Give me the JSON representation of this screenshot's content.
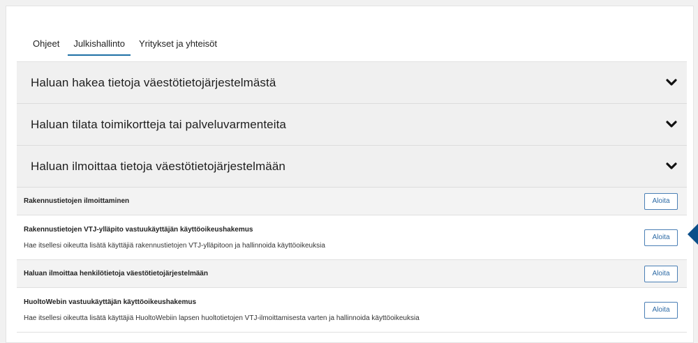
{
  "tabs": [
    {
      "label": "Ohjeet",
      "active": false
    },
    {
      "label": "Julkishallinto",
      "active": true
    },
    {
      "label": "Yritykset ja yhteisöt",
      "active": false
    }
  ],
  "accordion": [
    {
      "title": "Haluan hakea tietoja väestötietojärjestelmästä",
      "icon": "chevron-down-icon"
    },
    {
      "title": "Haluan tilata toimikortteja tai palveluvarmenteita",
      "icon": "chevron-down-icon"
    },
    {
      "title": "Haluan ilmoittaa tietoja väestötietojärjestelmään",
      "icon": "chevron-down-icon"
    }
  ],
  "rows": [
    {
      "title": "Rakennustietojen ilmoittaminen",
      "desc": "",
      "button": "Aloita"
    },
    {
      "title": "Rakennustietojen VTJ-ylläpito vastuukäyttäjän käyttöoikeushakemus",
      "desc": "Hae itsellesi oikeutta lisätä käyttäjiä rakennustietojen VTJ-ylläpitoon ja hallinnoida käyttöoikeuksia",
      "button": "Aloita"
    },
    {
      "title": "Haluan ilmoittaa henkilötietoja väestötietojärjestelmään",
      "desc": "",
      "button": "Aloita"
    },
    {
      "title": "HuoltoWebin vastuukäyttäjän käyttöoikeushakemus",
      "desc": "Hae itsellesi oikeutta lisätä käyttäjiä HuoltoWebiin lapsen huoltotietojen VTJ-ilmoittamisesta varten ja hallinnoida käyttöoikeuksia",
      "button": "Aloita"
    }
  ],
  "colors": {
    "accent": "#1d6fa5",
    "pointer": "#0b4f8a",
    "button_border": "#4a7fb5"
  }
}
